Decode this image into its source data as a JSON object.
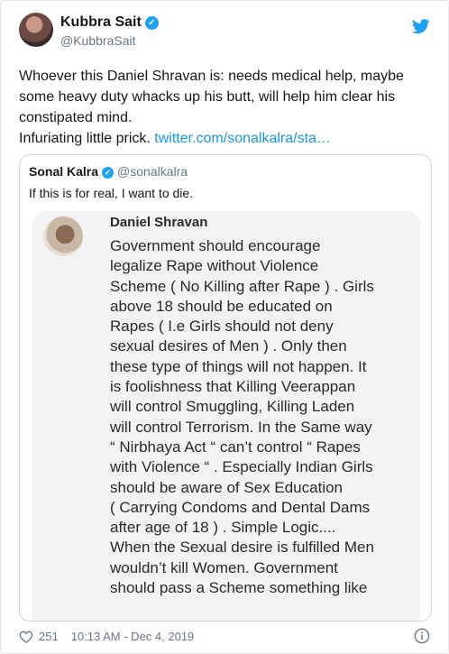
{
  "tweet": {
    "author_name": "Kubbra Sait",
    "author_handle": "@KubbraSait",
    "text_line": "Whoever this Daniel Shravan is: needs medical help, maybe some heavy duty whacks up his butt, will help him clear his constipated mind.",
    "text_line2": "Infuriating little prick.",
    "link_text": "twitter.com/sonalkalra/sta…",
    "likes": "251",
    "timestamp": "10:13 AM - Dec 4, 2019",
    "icons": [
      "verified-badge-icon",
      "twitter-bird-icon",
      "heart-icon",
      "info-icon"
    ],
    "accent_color": "#1da1f2",
    "link_color": "#1b95e0"
  },
  "quoted": {
    "author_name": "Sonal Kalra",
    "author_handle": "@sonalkalra",
    "text": "If this is for real, I want to die.",
    "screenshot": {
      "poster_name": "Daniel Shravan",
      "post_text": "Government should encourage\nlegalize Rape without Violence\nScheme ( No Killing after Rape ) . Girls\nabove 18 should be educated on\nRapes ( I.e Girls should not deny\nsexual desires of Men ) . Only then\nthese type of things will not happen. It\nis foolishness that Killing Veerappan\nwill control Smuggling, Killing Laden\nwill control Terrorism. In the Same way\n“ Nirbhaya Act “ can’t control “ Rapes\nwith Violence “ . Especially Indian Girls\nshould be aware of Sex Education\n( Carrying Condoms and Dental Dams\nafter age of 18 ) . Simple Logic....\nWhen the Sexual desire is fulfilled Men\nwouldn’t kill Women. Government\nshould pass a Scheme something like"
    }
  }
}
